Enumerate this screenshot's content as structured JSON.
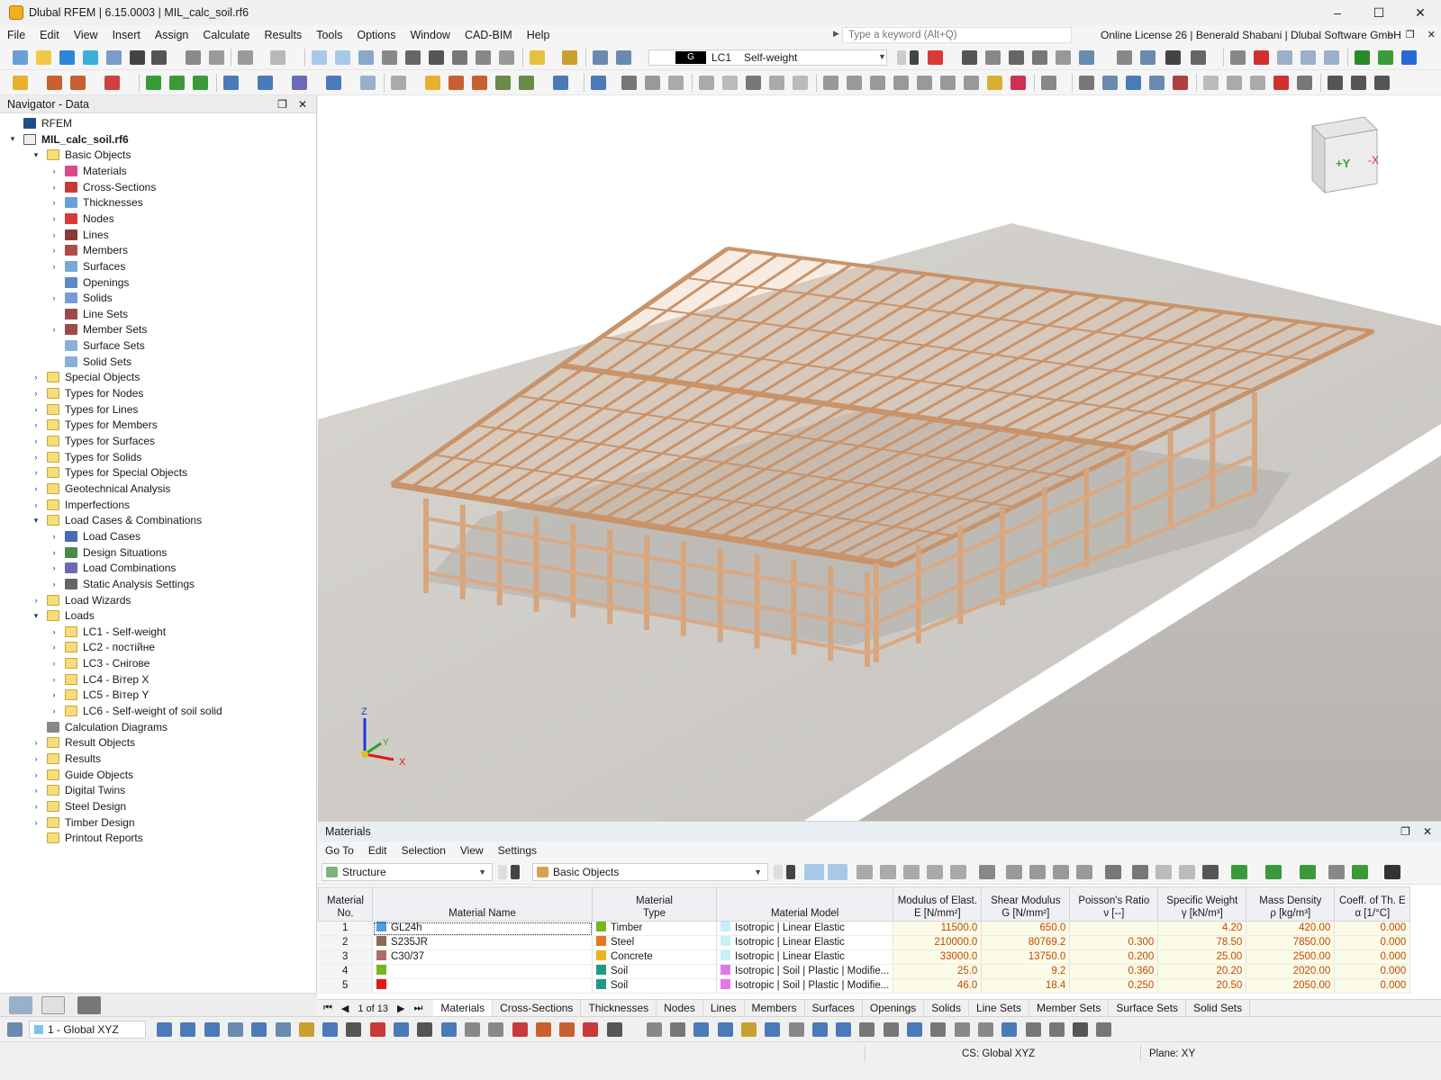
{
  "window": {
    "title": "Dlubal RFEM | 6.15.0003 | MIL_calc_soil.rf6",
    "minimize": "–",
    "maximize": "☐",
    "close": "✕"
  },
  "menu": {
    "items": [
      "File",
      "Edit",
      "View",
      "Insert",
      "Assign",
      "Calculate",
      "Results",
      "Tools",
      "Options",
      "Window",
      "CAD-BIM",
      "Help"
    ],
    "search_placeholder": "Type a keyword (Alt+Q)",
    "license": "Online License 26 | Benerald Shabani | Dlubal Software GmbH"
  },
  "toolbar": {
    "lc_badge": "G",
    "lc_code": "LC1",
    "lc_name": "Self-weight"
  },
  "navigator": {
    "title": "Navigator - Data",
    "items": [
      {
        "label": "RFEM",
        "level": 0,
        "caret": "",
        "icon": "rfem-icon"
      },
      {
        "label": "MIL_calc_soil.rf6",
        "level": 0,
        "caret": "▾",
        "icon": "file-icon",
        "bold": true
      },
      {
        "label": "Basic Objects",
        "level": 1,
        "caret": "▾",
        "icon": "folder-icon"
      },
      {
        "label": "Materials",
        "level": 2,
        "caret": "›",
        "icon": "materials-icon"
      },
      {
        "label": "Cross-Sections",
        "level": 2,
        "caret": "›",
        "icon": "cross-sections-icon"
      },
      {
        "label": "Thicknesses",
        "level": 2,
        "caret": "›",
        "icon": "thicknesses-icon"
      },
      {
        "label": "Nodes",
        "level": 2,
        "caret": "›",
        "icon": "nodes-icon"
      },
      {
        "label": "Lines",
        "level": 2,
        "caret": "›",
        "icon": "lines-icon"
      },
      {
        "label": "Members",
        "level": 2,
        "caret": "›",
        "icon": "members-icon"
      },
      {
        "label": "Surfaces",
        "level": 2,
        "caret": "›",
        "icon": "surfaces-icon"
      },
      {
        "label": "Openings",
        "level": 2,
        "caret": "",
        "icon": "openings-icon"
      },
      {
        "label": "Solids",
        "level": 2,
        "caret": "›",
        "icon": "solids-icon"
      },
      {
        "label": "Line Sets",
        "level": 2,
        "caret": "",
        "icon": "line-sets-icon"
      },
      {
        "label": "Member Sets",
        "level": 2,
        "caret": "›",
        "icon": "member-sets-icon"
      },
      {
        "label": "Surface Sets",
        "level": 2,
        "caret": "",
        "icon": "surface-sets-icon"
      },
      {
        "label": "Solid Sets",
        "level": 2,
        "caret": "",
        "icon": "solid-sets-icon"
      },
      {
        "label": "Special Objects",
        "level": 1,
        "caret": "›",
        "icon": "folder-icon"
      },
      {
        "label": "Types for Nodes",
        "level": 1,
        "caret": "›",
        "icon": "folder-icon"
      },
      {
        "label": "Types for Lines",
        "level": 1,
        "caret": "›",
        "icon": "folder-icon"
      },
      {
        "label": "Types for Members",
        "level": 1,
        "caret": "›",
        "icon": "folder-icon"
      },
      {
        "label": "Types for Surfaces",
        "level": 1,
        "caret": "›",
        "icon": "folder-icon"
      },
      {
        "label": "Types for Solids",
        "level": 1,
        "caret": "›",
        "icon": "folder-icon"
      },
      {
        "label": "Types for Special Objects",
        "level": 1,
        "caret": "›",
        "icon": "folder-icon"
      },
      {
        "label": "Geotechnical Analysis",
        "level": 1,
        "caret": "›",
        "icon": "folder-icon"
      },
      {
        "label": "Imperfections",
        "level": 1,
        "caret": "›",
        "icon": "folder-icon"
      },
      {
        "label": "Load Cases & Combinations",
        "level": 1,
        "caret": "▾",
        "icon": "folder-icon"
      },
      {
        "label": "Load Cases",
        "level": 2,
        "caret": "›",
        "icon": "load-cases-icon"
      },
      {
        "label": "Design Situations",
        "level": 2,
        "caret": "›",
        "icon": "design-situations-icon"
      },
      {
        "label": "Load Combinations",
        "level": 2,
        "caret": "›",
        "icon": "load-combinations-icon"
      },
      {
        "label": "Static Analysis Settings",
        "level": 2,
        "caret": "›",
        "icon": "analysis-settings-icon"
      },
      {
        "label": "Load Wizards",
        "level": 1,
        "caret": "›",
        "icon": "folder-icon"
      },
      {
        "label": "Loads",
        "level": 1,
        "caret": "▾",
        "icon": "folder-icon"
      },
      {
        "label": "LC1 - Self-weight",
        "level": 2,
        "caret": "›",
        "icon": "folder-icon"
      },
      {
        "label": "LC2 - постійне",
        "level": 2,
        "caret": "›",
        "icon": "folder-icon"
      },
      {
        "label": "LC3 - Снігове",
        "level": 2,
        "caret": "›",
        "icon": "folder-icon"
      },
      {
        "label": "LC4 - Вітер X",
        "level": 2,
        "caret": "›",
        "icon": "folder-icon"
      },
      {
        "label": "LC5 - Вітер Y",
        "level": 2,
        "caret": "›",
        "icon": "folder-icon"
      },
      {
        "label": "LC6 - Self-weight of soil solid",
        "level": 2,
        "caret": "›",
        "icon": "folder-icon"
      },
      {
        "label": "Calculation Diagrams",
        "level": 1,
        "caret": "",
        "icon": "diagram-icon"
      },
      {
        "label": "Result Objects",
        "level": 1,
        "caret": "›",
        "icon": "folder-icon"
      },
      {
        "label": "Results",
        "level": 1,
        "caret": "›",
        "icon": "folder-icon"
      },
      {
        "label": "Guide Objects",
        "level": 1,
        "caret": "›",
        "icon": "folder-icon"
      },
      {
        "label": "Digital Twins",
        "level": 1,
        "caret": "›",
        "icon": "folder-icon"
      },
      {
        "label": "Steel Design",
        "level": 1,
        "caret": "›",
        "icon": "folder-icon"
      },
      {
        "label": "Timber Design",
        "level": 1,
        "caret": "›",
        "icon": "folder-icon"
      },
      {
        "label": "Printout Reports",
        "level": 1,
        "caret": "",
        "icon": "folder-icon"
      }
    ]
  },
  "viewport": {
    "cube_plus_y": "+Y",
    "cube_minus_x": "-X",
    "axis_x": "X",
    "axis_y": "Y",
    "axis_z": "Z"
  },
  "materials": {
    "title": "Materials",
    "menu": [
      "Go To",
      "Edit",
      "Selection",
      "View",
      "Settings"
    ],
    "combo_structure": "Structure",
    "combo_objects": "Basic Objects",
    "columns": [
      {
        "l1": "Material",
        "l2": "No."
      },
      {
        "l1": "",
        "l2": "Material Name"
      },
      {
        "l1": "Material",
        "l2": "Type"
      },
      {
        "l1": "",
        "l2": "Material Model"
      },
      {
        "l1": "Modulus of Elast.",
        "l2": "E [N/mm²]"
      },
      {
        "l1": "Shear Modulus",
        "l2": "G [N/mm²]"
      },
      {
        "l1": "Poisson's Ratio",
        "l2": "ν [--]"
      },
      {
        "l1": "Specific Weight",
        "l2": "γ [kN/m³]"
      },
      {
        "l1": "Mass Density",
        "l2": "ρ [kg/m³]"
      },
      {
        "l1": "Coeff. of Th. E",
        "l2": "α [1/°C]"
      }
    ],
    "rows": [
      {
        "no": "1",
        "name": "GL24h",
        "name_color": "#4a9ee8",
        "type": "Timber",
        "type_color": "#7ab51d",
        "model": "Isotropic | Linear Elastic",
        "model_color": "#c6f0f8",
        "e": "11500.0",
        "g": "650.0",
        "nu": "",
        "gamma": "4.20",
        "rho": "420.00",
        "alpha": "0.000"
      },
      {
        "no": "2",
        "name": "S235JR",
        "name_color": "#8a6b55",
        "type": "Steel",
        "type_color": "#e8742a",
        "model": "Isotropic | Linear Elastic",
        "model_color": "#c6f0f8",
        "e": "210000.0",
        "g": "80769.2",
        "nu": "0.300",
        "gamma": "78.50",
        "rho": "7850.00",
        "alpha": "0.000"
      },
      {
        "no": "3",
        "name": "C30/37",
        "name_color": "#b06a6a",
        "type": "Concrete",
        "type_color": "#f0b41e",
        "model": "Isotropic | Linear Elastic",
        "model_color": "#c6f0f8",
        "e": "33000.0",
        "g": "13750.0",
        "nu": "0.200",
        "gamma": "25.00",
        "rho": "2500.00",
        "alpha": "0.000"
      },
      {
        "no": "4",
        "name": "",
        "name_color": "#7ab51d",
        "type": "Soil",
        "type_color": "#1f9a88",
        "model": "Isotropic | Soil | Plastic | Modifie...",
        "model_color": "#e07ae8",
        "e": "25.0",
        "g": "9.2",
        "nu": "0.360",
        "gamma": "20.20",
        "rho": "2020.00",
        "alpha": "0.000"
      },
      {
        "no": "5",
        "name": "",
        "name_color": "#e01818",
        "type": "Soil",
        "type_color": "#1f9a88",
        "model": "Isotropic | Soil | Plastic | Modifie...",
        "model_color": "#e07ae8",
        "e": "46.0",
        "g": "18.4",
        "nu": "0.250",
        "gamma": "20.50",
        "rho": "2050.00",
        "alpha": "0.000"
      }
    ],
    "pager": "1 of 13",
    "tabs": [
      "Materials",
      "Cross-Sections",
      "Thicknesses",
      "Nodes",
      "Lines",
      "Members",
      "Surfaces",
      "Openings",
      "Solids",
      "Line Sets",
      "Member Sets",
      "Surface Sets",
      "Solid Sets"
    ]
  },
  "status": {
    "view": "1 - Global XYZ",
    "cs": "CS: Global XYZ",
    "plane": "Plane: XY"
  }
}
